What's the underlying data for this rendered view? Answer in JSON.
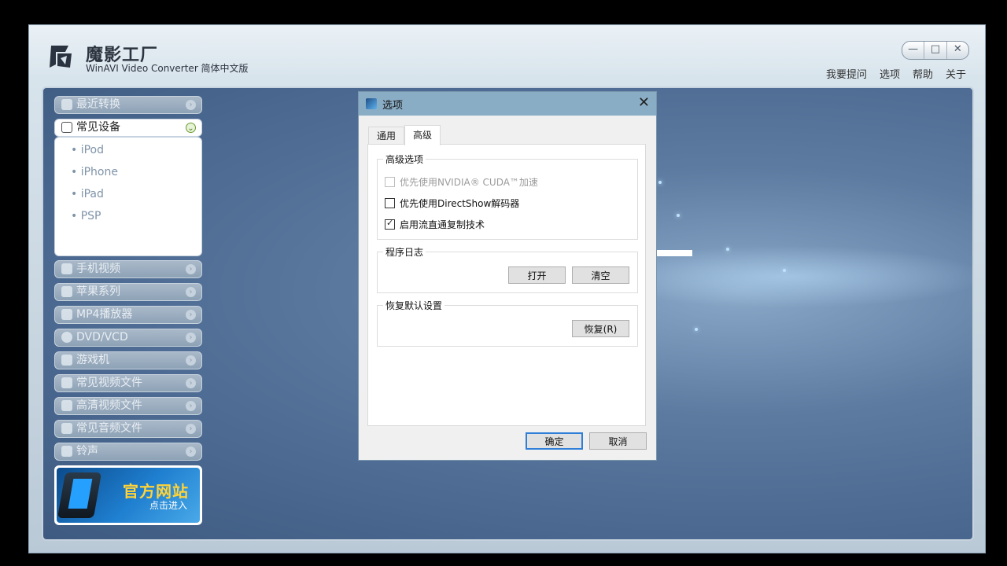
{
  "app": {
    "brand_title": "魔影工厂",
    "brand_subtitle": "WinAVI Video Converter 简体中文版",
    "window_controls": [
      "—",
      "□",
      "✕"
    ],
    "top_menu": [
      "我要提问",
      "选项",
      "帮助",
      "关于"
    ]
  },
  "sidebar": {
    "recent": "最近转换",
    "common_devices": {
      "label": "常见设备",
      "items": [
        "iPod",
        "iPhone",
        "iPad",
        "PSP"
      ]
    },
    "categories": [
      {
        "label": "手机视频",
        "icon": "phone-icon"
      },
      {
        "label": "苹果系列",
        "icon": "apple-icon"
      },
      {
        "label": "MP4播放器",
        "icon": "mp4-player-icon"
      },
      {
        "label": "DVD/VCD",
        "icon": "disc-icon"
      },
      {
        "label": "游戏机",
        "icon": "gamepad-icon"
      },
      {
        "label": "常见视频文件",
        "icon": "film-icon"
      },
      {
        "label": "高清视频文件",
        "icon": "hd-icon"
      },
      {
        "label": "常见音频文件",
        "icon": "music-note-icon"
      },
      {
        "label": "铃声",
        "icon": "bell-icon"
      }
    ],
    "banner": {
      "title": "官方网站",
      "subtitle": "点击进入"
    }
  },
  "dialog": {
    "title": "选项",
    "tabs": [
      "通用",
      "高级"
    ],
    "active_tab": "高级",
    "advanced_group": {
      "legend": "高级选项",
      "options": [
        {
          "label": "优先使用NVIDIA® CUDA™加速",
          "checked": false,
          "disabled": true
        },
        {
          "label": "优先使用DirectShow解码器",
          "checked": false,
          "disabled": false
        },
        {
          "label": "启用流直通复制技术",
          "checked": true,
          "disabled": false
        }
      ]
    },
    "log_group": {
      "legend": "程序日志",
      "open_label": "打开",
      "clear_label": "清空"
    },
    "restore_group": {
      "legend": "恢复默认设置",
      "restore_label": "恢复(R)"
    },
    "ok_label": "确定",
    "cancel_label": "取消"
  }
}
